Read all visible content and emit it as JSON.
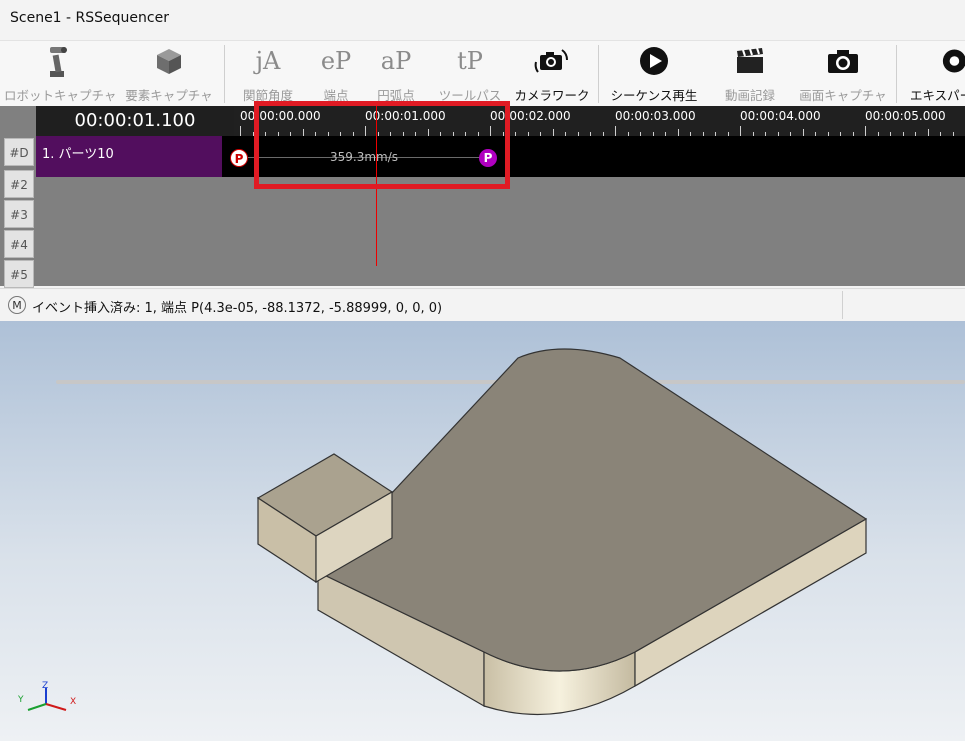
{
  "window": {
    "title": "Scene1 - RSSequencer"
  },
  "toolbar": {
    "robot_capture": "ロボットキャプチャ",
    "element_capture": "要素キャプチャ",
    "joint_angle": "関節角度",
    "endpoint": "端点",
    "arc_point": "円弧点",
    "tool_path": "ツールパス",
    "camera_work": "カメラワーク",
    "sequence_play": "シーケンス再生",
    "video_record": "動画記録",
    "screen_capture": "画面キャプチャ",
    "export": "エキスパー",
    "joint_glyph": "jA",
    "endpoint_glyph": "eP",
    "arc_glyph": "aP",
    "tool_glyph": "tP"
  },
  "timeline": {
    "current_time": "00:00:01.100",
    "ruler": [
      "00:00:00.000",
      "00:00:01.000",
      "00:00:02.000",
      "00:00:03.000",
      "00:00:04.000",
      "00:00:05.000"
    ],
    "rows": [
      "#D",
      "#2",
      "#3",
      "#4",
      "#5"
    ],
    "part_label": "1. パーツ10",
    "p_start": "P",
    "p_end": "P",
    "speed": "359.3mm/s",
    "playhead_time_s": 1.1
  },
  "status": {
    "icon": "M",
    "message": "イベント挿入済み: 1, 端点 P(4.3e-05, -88.1372, -5.88999, 0, 0, 0)"
  },
  "axes": {
    "x": "X",
    "y": "Y",
    "z": "Z"
  },
  "colors": {
    "part_label_bg": "#520e5e",
    "highlight": "#e01b24",
    "playhead": "#e00000",
    "end_marker": "#b000c0",
    "model_top": "#8a8478",
    "model_side": "#cfc6b0"
  }
}
